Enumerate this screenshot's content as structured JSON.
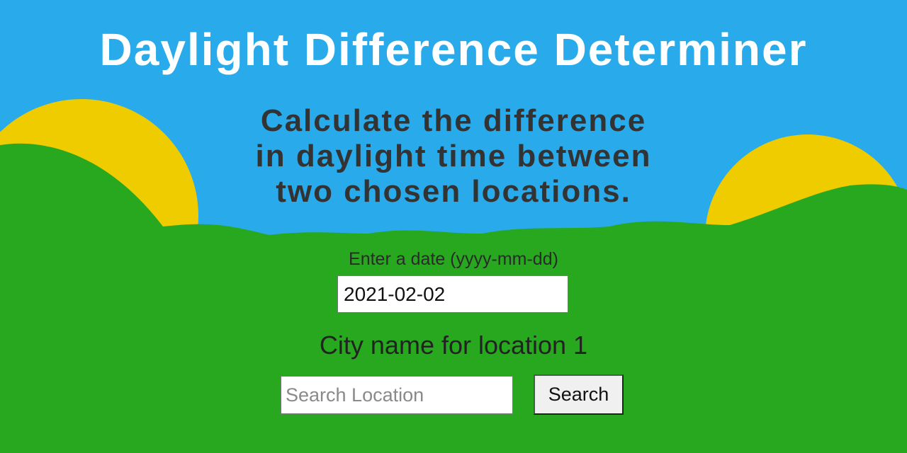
{
  "colors": {
    "sky": "#29abeb",
    "sun": "#eecc00",
    "hills": "#27a81f",
    "title_text": "#ffffff",
    "subtitle_text": "#333333"
  },
  "header": {
    "title": "Daylight Difference Determiner",
    "subtitle_lines": [
      "Calculate the difference",
      "in daylight time between",
      "two chosen locations."
    ]
  },
  "form": {
    "date_label": "Enter a date (yyyy-mm-dd)",
    "date_value": "2021-02-02",
    "city_label": "City name for location 1",
    "search_placeholder": "Search Location",
    "search_button": "Search"
  }
}
